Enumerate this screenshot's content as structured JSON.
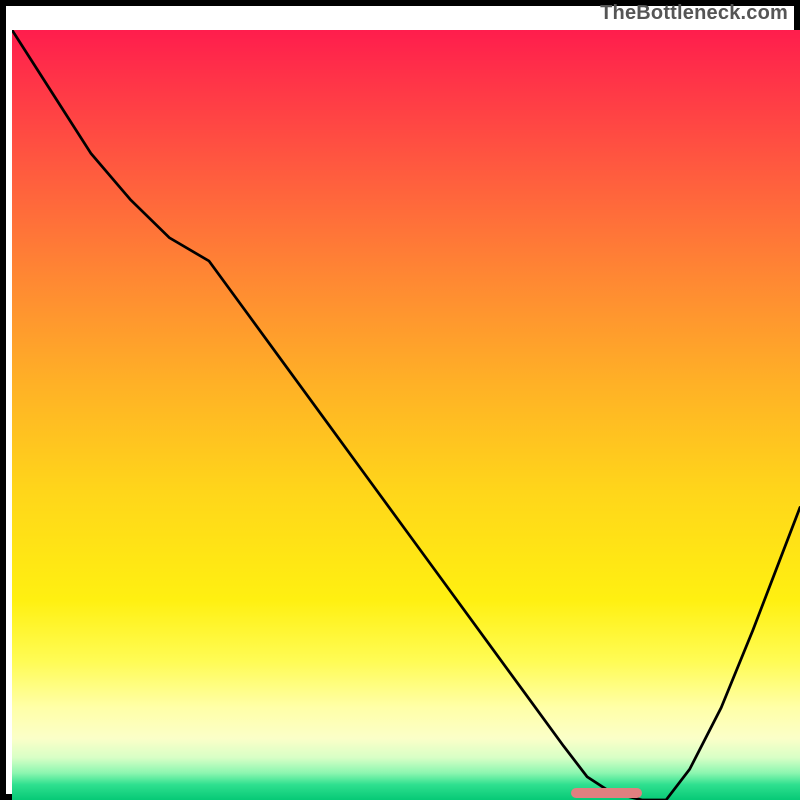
{
  "caption": "TheBottleneck.com",
  "marker": {
    "left_pct": 71.0,
    "top_pct": 98.4,
    "width_pct": 9.0,
    "height_pct": 1.3
  },
  "chart_data": {
    "type": "line",
    "title": "",
    "xlabel": "",
    "ylabel": "",
    "xlim": [
      0,
      100
    ],
    "ylim": [
      0,
      100
    ],
    "series": [
      {
        "name": "bottleneck-curve",
        "x": [
          0,
          5,
          10,
          15,
          20,
          25,
          30,
          35,
          40,
          45,
          50,
          55,
          60,
          65,
          70,
          73,
          76,
          80,
          83,
          86,
          90,
          94,
          97,
          100
        ],
        "y": [
          100,
          92,
          84,
          78,
          73,
          70,
          63,
          56,
          49,
          42,
          35,
          28,
          21,
          14,
          7,
          3,
          1,
          0,
          0,
          4,
          12,
          22,
          30,
          38
        ]
      }
    ],
    "optimal_range_x": [
      71,
      80
    ]
  }
}
